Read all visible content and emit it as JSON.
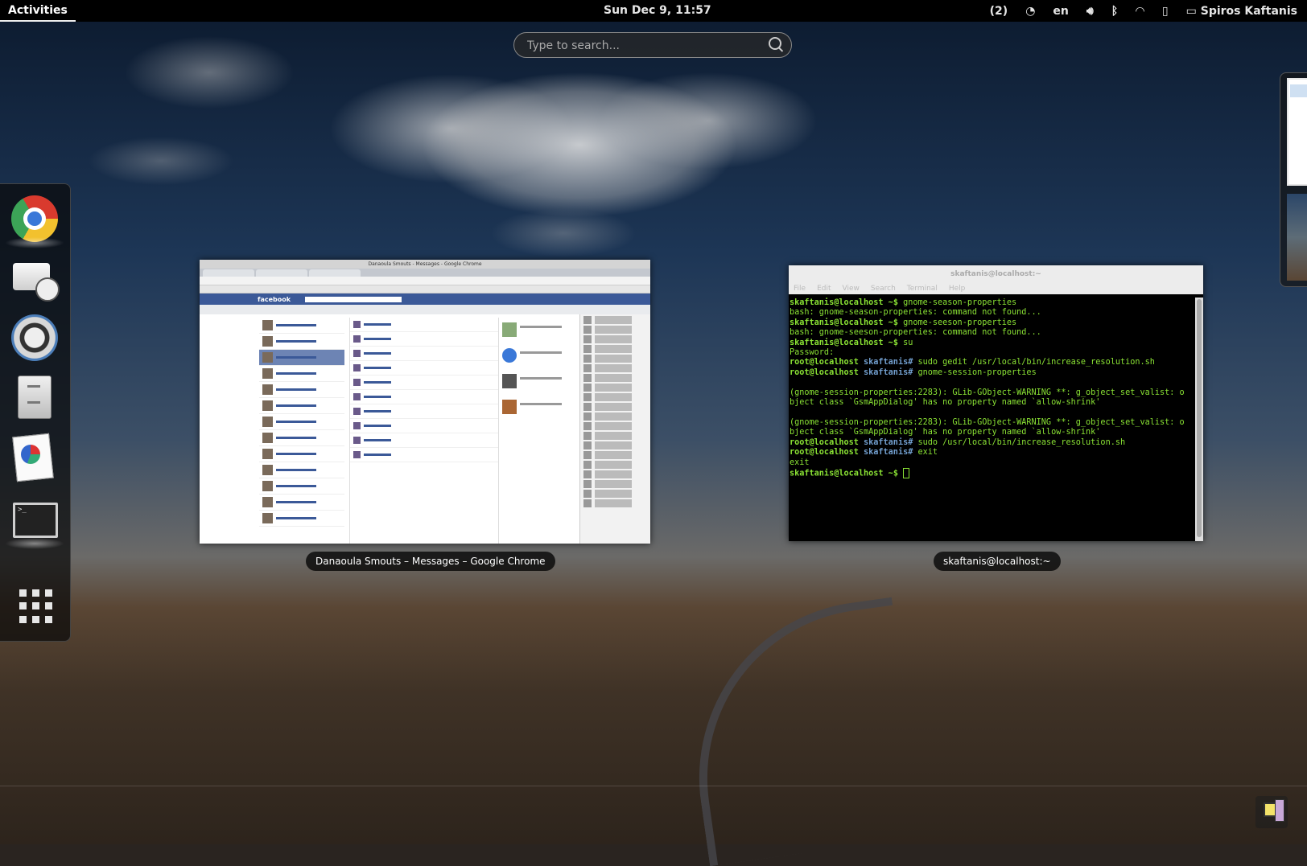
{
  "topbar": {
    "activities_label": "Activities",
    "clock": "Sun Dec  9, 11:57",
    "notification_count": "(2)",
    "keyboard_layout": "en",
    "user_name": "Spiros Kaftanis"
  },
  "search": {
    "placeholder": "Type to search..."
  },
  "dash": {
    "apps": [
      {
        "name": "Google Chrome",
        "icon": "chrome-icon",
        "running": true
      },
      {
        "name": "Evolution",
        "icon": "mail-clock-icon",
        "running": false
      },
      {
        "name": "Rhythmbox",
        "icon": "speaker-icon",
        "running": false
      },
      {
        "name": "Files",
        "icon": "file-cabinet-icon",
        "running": false
      },
      {
        "name": "Documents",
        "icon": "documents-icon",
        "running": false
      },
      {
        "name": "Terminal",
        "icon": "terminal-icon",
        "running": true
      },
      {
        "name": "Show Applications",
        "icon": "app-grid-icon",
        "running": false
      }
    ]
  },
  "windows": {
    "chrome": {
      "title": "Danaoula Smouts - Messages - Google Chrome",
      "caption": "Danaoula Smouts – Messages – Google Chrome",
      "fb_logo": "facebook"
    },
    "terminal": {
      "title": "skaftanis@localhost:~",
      "caption": "skaftanis@localhost:~",
      "menu": [
        "File",
        "Edit",
        "View",
        "Search",
        "Terminal",
        "Help"
      ],
      "lines": [
        {
          "prompt_user": "skaftanis@localhost",
          "prompt_rest": " ~$ ",
          "cmd": "gnome-season-properties"
        },
        {
          "text": "bash: gnome-season-properties: command not found..."
        },
        {
          "prompt_user": "skaftanis@localhost",
          "prompt_rest": " ~$ ",
          "cmd": "gnome-seeson-properties"
        },
        {
          "text": "bash: gnome-seeson-properties: command not found..."
        },
        {
          "prompt_user": "skaftanis@localhost",
          "prompt_rest": " ~$ ",
          "cmd": "su"
        },
        {
          "text": "Password:"
        },
        {
          "root_prompt": "root@localhost",
          "root_dir": " skaftanis",
          "root_hash": "# ",
          "cmd": "sudo gedit /usr/local/bin/increase_resolution.sh"
        },
        {
          "root_prompt": "root@localhost",
          "root_dir": " skaftanis",
          "root_hash": "# ",
          "cmd": "gnome-session-properties"
        },
        {
          "text": ""
        },
        {
          "text": "(gnome-session-properties:2283): GLib-GObject-WARNING **: g_object_set_valist: o"
        },
        {
          "text": "bject class `GsmAppDialog' has no property named `allow-shrink'"
        },
        {
          "text": ""
        },
        {
          "text": "(gnome-session-properties:2283): GLib-GObject-WARNING **: g_object_set_valist: o"
        },
        {
          "text": "bject class `GsmAppDialog' has no property named `allow-shrink'"
        },
        {
          "root_prompt": "root@localhost",
          "root_dir": " skaftanis",
          "root_hash": "# ",
          "cmd": "sudo /usr/local/bin/increase_resolution.sh"
        },
        {
          "root_prompt": "root@localhost",
          "root_dir": " skaftanis",
          "root_hash": "# ",
          "cmd": "exit"
        },
        {
          "text": "exit"
        },
        {
          "prompt_user": "skaftanis@localhost",
          "prompt_rest": " ~$ ",
          "cmd": "",
          "cursor": true
        }
      ]
    }
  }
}
